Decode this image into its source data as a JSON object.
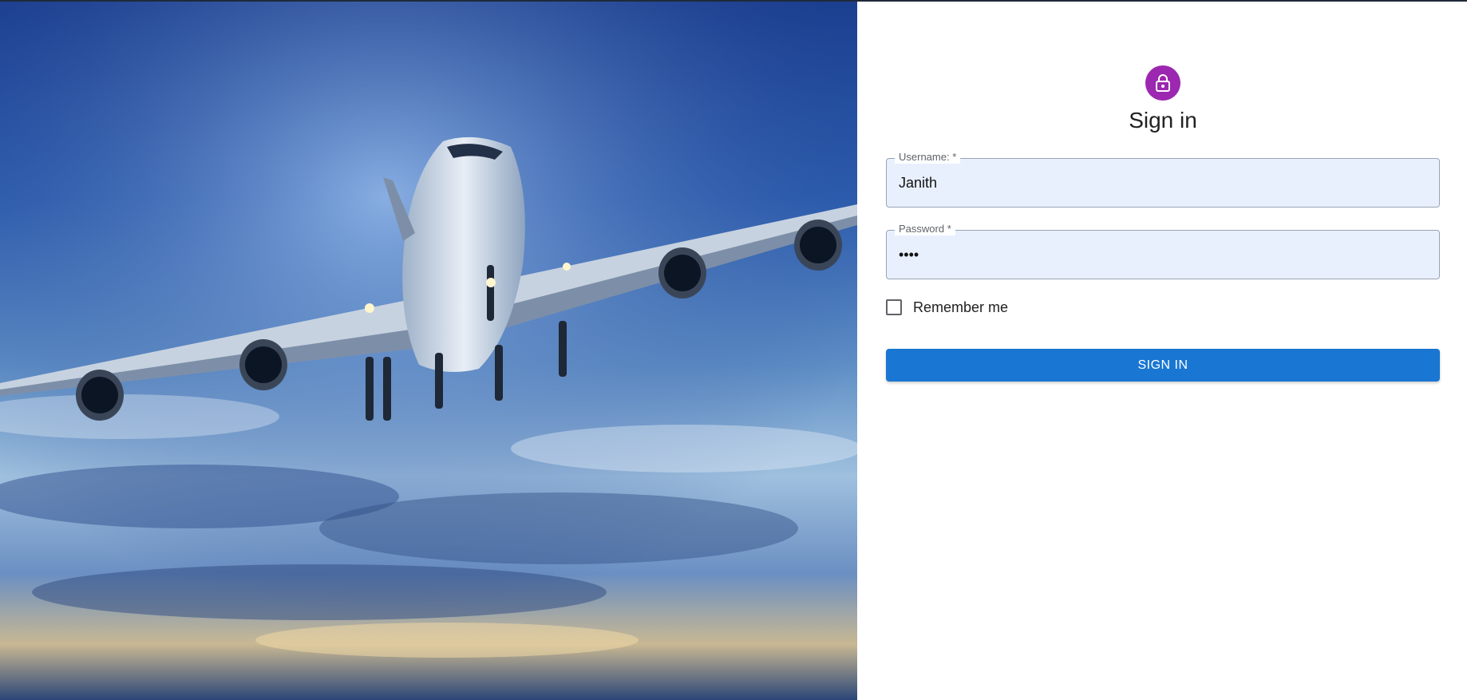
{
  "hero": {
    "image": "airplane-in-sky"
  },
  "auth": {
    "icon": "lock-icon",
    "title": "Sign in",
    "username": {
      "label": "Username: *",
      "value": "Janith"
    },
    "password": {
      "label": "Password *",
      "value": "••••"
    },
    "remember_label": "Remember me",
    "submit_label": "SIGN IN"
  },
  "colors": {
    "accent": "#9c27b0",
    "primary": "#1976d2",
    "autofill": "#e8f0fe"
  }
}
